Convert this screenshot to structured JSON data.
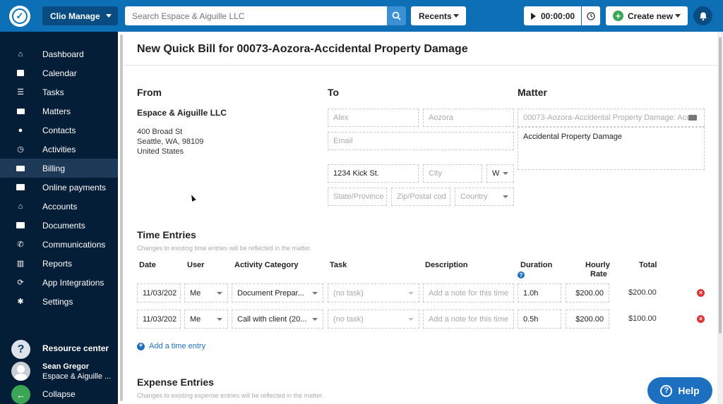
{
  "header": {
    "app_switcher": "Clio Manage",
    "search_placeholder": "Search Espace & Aiguille LLC",
    "recents": "Recents",
    "timer": "00:00:00",
    "create_new": "Create new"
  },
  "sidebar": {
    "items": [
      {
        "label": "Dashboard",
        "icon": "home-icon"
      },
      {
        "label": "Calendar",
        "icon": "calendar-icon"
      },
      {
        "label": "Tasks",
        "icon": "list-icon"
      },
      {
        "label": "Matters",
        "icon": "briefcase-icon"
      },
      {
        "label": "Contacts",
        "icon": "person-icon"
      },
      {
        "label": "Activities",
        "icon": "clock-icon"
      },
      {
        "label": "Billing",
        "icon": "money-icon"
      },
      {
        "label": "Online payments",
        "icon": "card-icon"
      },
      {
        "label": "Accounts",
        "icon": "bank-icon"
      },
      {
        "label": "Documents",
        "icon": "folder-icon"
      },
      {
        "label": "Communications",
        "icon": "phone-icon"
      },
      {
        "label": "Reports",
        "icon": "bar-chart-icon"
      },
      {
        "label": "App Integrations",
        "icon": "sync-icon"
      },
      {
        "label": "Settings",
        "icon": "gear-icon"
      }
    ],
    "active": "Billing",
    "resource_center": "Resource center",
    "user_name": "Sean Gregor",
    "user_firm": "Espace & Aiguille ...",
    "collapse": "Collapse"
  },
  "page": {
    "title": "New Quick Bill for 00073-Aozora-Accidental Property Damage",
    "from": {
      "heading": "From",
      "name": "Espace & Aiguille LLC",
      "street": "400 Broad St",
      "city_line": "Seattle, WA, 98109",
      "country": "United States"
    },
    "to": {
      "heading": "To",
      "first_name": "Alex",
      "last_name": "Aozora",
      "email_placeholder": "Email",
      "street": "1234 Kick St.",
      "city_placeholder": "City",
      "state_short": "W",
      "state_placeholder": "State/Province",
      "zip_placeholder": "Zip/Postal cod",
      "country_placeholder": "Country"
    },
    "matter": {
      "heading": "Matter",
      "select": "00073-Aozora-Accidental Property Damage: Accid",
      "description": "Accidental Property Damage"
    },
    "time_entries": {
      "heading": "Time Entries",
      "note": "Changes to existing time entries will be reflected in the matter.",
      "columns": {
        "date": "Date",
        "user": "User",
        "activity": "Activity Category",
        "task": "Task",
        "description": "Description",
        "duration": "Duration",
        "rate_1": "Hourly",
        "rate_2": "Rate",
        "total": "Total"
      },
      "rows": [
        {
          "date": "11/03/202",
          "user": "Me",
          "activity": "Document Prepar...",
          "task": "(no task)",
          "desc_placeholder": "Add a note for this time",
          "duration": "1.0h",
          "rate": "$200.00",
          "total": "$200.00"
        },
        {
          "date": "11/03/202",
          "user": "Me",
          "activity": "Call with client (20...",
          "task": "(no task)",
          "desc_placeholder": "Add a note for this time",
          "duration": "0.5h",
          "rate": "$200.00",
          "total": "$100.00"
        }
      ],
      "add_link": "Add a time entry"
    },
    "expense_entries": {
      "heading": "Expense Entries",
      "note": "Changes to existing expense entries will be reflected in the matter."
    }
  },
  "help_button": "Help",
  "colors": {
    "brand": "#0d70b7",
    "sidebar": "#051e38",
    "accent": "#3aa655",
    "link": "#1d6fc0"
  }
}
